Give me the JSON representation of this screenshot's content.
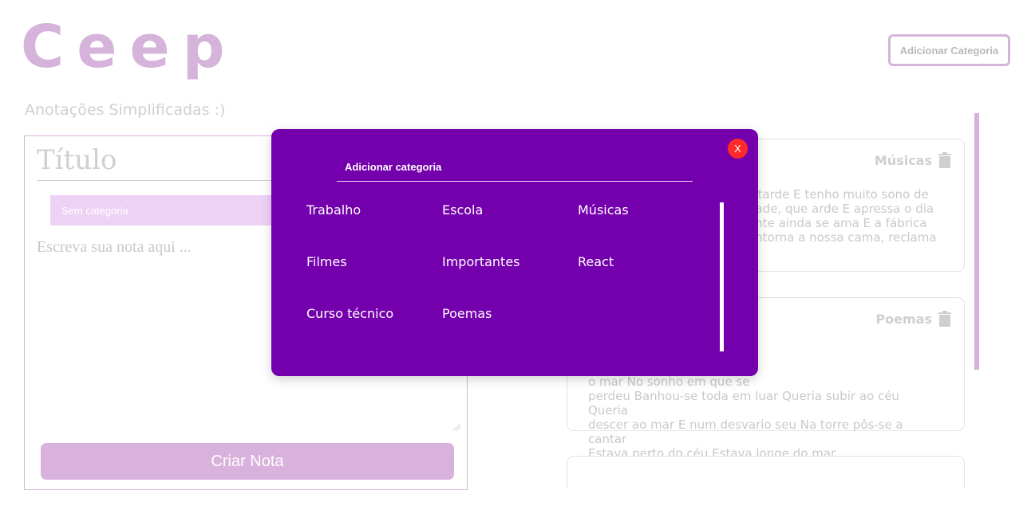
{
  "header": {
    "logo": "Ceep",
    "subtitle": "Anotações Simplificadas :)",
    "add_category_button": "Adicionar Categoria"
  },
  "form": {
    "title_placeholder": "Título",
    "category_select_value": "Sem categoria",
    "note_placeholder": "Escreva sua nota aqui ...",
    "create_button": "Criar Nota"
  },
  "notes": [
    {
      "category": "Músicas",
      "text": "s tarde E tenho muito sono de\ndade, que arde E apressa o dia\nente ainda se ama E a fábrica\nontorna a nossa cama, reclama"
    },
    {
      "category": "Poemas",
      "text": "Pôs-se na torre a sonhar Viu\no mar No sonho em que se\nperdeu Banhou-se toda em luar Queria subir ao céu Queria\ndescer ao mar E num desvario seu Na torre pôs-se a cantar\nEstava perto do céu Estava longe do mar"
    }
  ],
  "modal": {
    "close_label": "X",
    "input_value": "Adicionar categoria",
    "categories": [
      "Trabalho",
      "Escola",
      "Músicas",
      "Filmes",
      "Importantes",
      "React",
      "Curso técnico",
      "Poemas"
    ]
  },
  "colors": {
    "accent": "#d8b2dd",
    "modal_bg": "#7400ad",
    "close_red": "#ff2b2b"
  }
}
